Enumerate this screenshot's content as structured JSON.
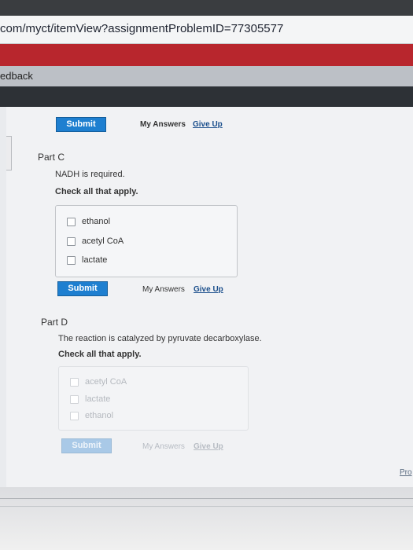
{
  "browser": {
    "url": "com/myct/itemView?assignmentProblemID=77305577"
  },
  "header": {
    "feedback_label": "edback"
  },
  "prev_controls": {
    "submit_label": "Submit",
    "my_answers_label": "My Answers",
    "give_up_label": "Give Up"
  },
  "part_c": {
    "title": "Part C",
    "prompt": "NADH is required.",
    "instruction": "Check all that apply.",
    "options": [
      "ethanol",
      "acetyl CoA",
      "lactate"
    ],
    "submit_label": "Submit",
    "my_answers_label": "My Answers",
    "give_up_label": "Give Up"
  },
  "part_d": {
    "title": "Part D",
    "prompt": "The reaction is catalyzed by pyruvate decarboxylase.",
    "instruction": "Check all that apply.",
    "options": [
      "acetyl CoA",
      "lactate",
      "ethanol"
    ],
    "submit_label": "Submit",
    "my_answers_label": "My Answers",
    "give_up_label": "Give Up"
  },
  "footer": {
    "link_label": "Pro"
  },
  "colors": {
    "accent_button": "#1e7fd0",
    "header_red": "#b8262d"
  }
}
